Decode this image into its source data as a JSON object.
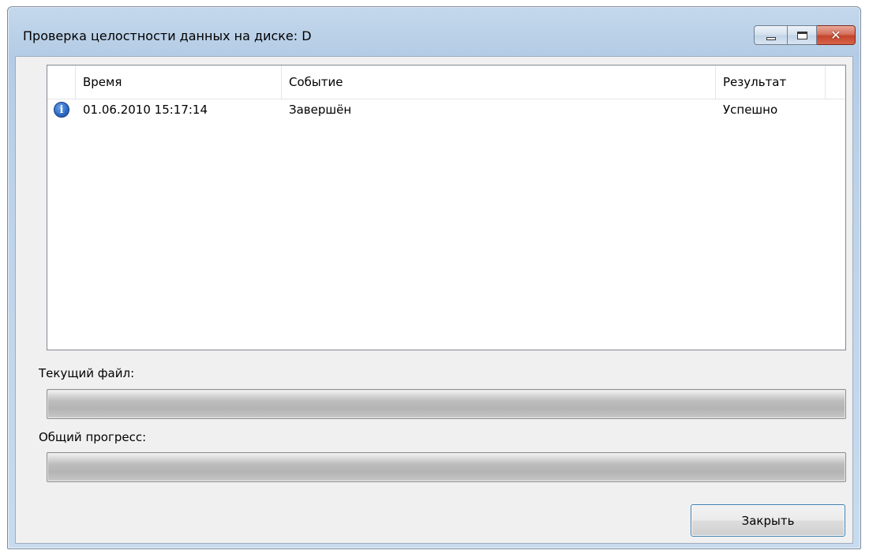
{
  "window": {
    "title": "Проверка целостности данных на диске: D",
    "caption": {
      "minimize_icon": "minimize-icon",
      "maximize_icon": "maximize-icon",
      "close_icon": "close-icon",
      "close_glyph": "✕"
    }
  },
  "log": {
    "columns": {
      "time": "Время",
      "event": "Событие",
      "result": "Результат"
    },
    "rows": [
      {
        "icon": "info-icon",
        "icon_glyph": "i",
        "time": "01.06.2010 15:17:14",
        "event": "Завершён",
        "result": "Успешно"
      }
    ]
  },
  "current_file": {
    "label": "Текущий файл:",
    "progress": 0
  },
  "overall_progress": {
    "label": "Общий прогресс:",
    "progress": 0
  },
  "buttons": {
    "close_label": "Закрыть"
  },
  "colors": {
    "progress_fill": "#06b025",
    "button_border": "#3c7fb1",
    "close_caption": "#c2452c"
  }
}
